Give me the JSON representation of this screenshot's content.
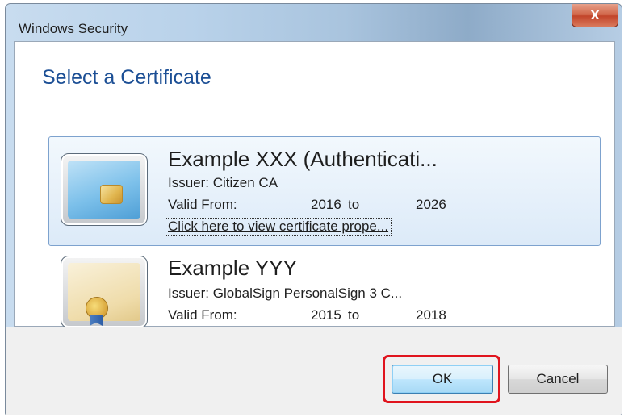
{
  "window": {
    "title": "Windows Security",
    "close_glyph": "x",
    "close_icon": "close-icon"
  },
  "dialog": {
    "heading": "Select a Certificate"
  },
  "certificates": [
    {
      "name": "Example XXX  (Authenticati...",
      "issuer": "Issuer: Citizen CA",
      "valid_label": "Valid From:",
      "from_year": "2016",
      "to_word": "to",
      "to_year": "2026",
      "link": "Click here to view certificate prope...",
      "icon": "smart-card-icon",
      "selected": true
    },
    {
      "name": "Example YYY",
      "issuer": "Issuer: GlobalSign PersonalSign 3 C...",
      "valid_label": "Valid From:",
      "from_year": "2015",
      "to_word": "to",
      "to_year": "2018",
      "icon": "certificate-document-icon",
      "selected": false
    }
  ],
  "buttons": {
    "ok": "OK",
    "cancel": "Cancel"
  },
  "colors": {
    "heading": "#1c4f95",
    "selection": "#dceaf8",
    "highlight": "#e0141e",
    "close": "#c2452a"
  }
}
